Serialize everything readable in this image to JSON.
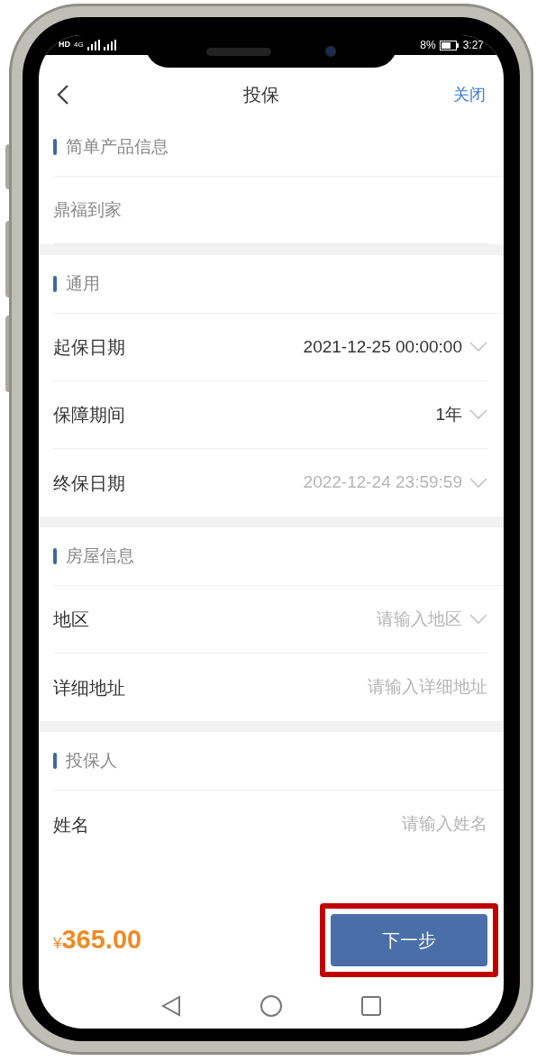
{
  "status_bar": {
    "left": "HD",
    "network": "4G",
    "battery": "8%",
    "time": "3:27"
  },
  "header": {
    "title": "投保",
    "close": "关闭"
  },
  "sections": [
    {
      "title": "简单产品信息",
      "rows": [
        {
          "kind": "text",
          "label": "鼎福到家"
        }
      ]
    },
    {
      "title": "通用",
      "rows": [
        {
          "kind": "select",
          "label": "起保日期",
          "value": "2021-12-25 00:00:00",
          "disabled": false
        },
        {
          "kind": "select",
          "label": "保障期间",
          "value": "1年",
          "disabled": false
        },
        {
          "kind": "select",
          "label": "终保日期",
          "value": "2022-12-24 23:59:59",
          "disabled": true
        }
      ]
    },
    {
      "title": "房屋信息",
      "rows": [
        {
          "kind": "select",
          "label": "地区",
          "placeholder": "请输入地区"
        },
        {
          "kind": "input",
          "label": "详细地址",
          "placeholder": "请输入详细地址"
        }
      ]
    },
    {
      "title": "投保人",
      "rows": [
        {
          "kind": "input",
          "label": "姓名",
          "placeholder": "请输入姓名"
        }
      ]
    }
  ],
  "footer": {
    "currency": "¥",
    "price": "365.00",
    "button": "下一步",
    "highlighted": true
  }
}
